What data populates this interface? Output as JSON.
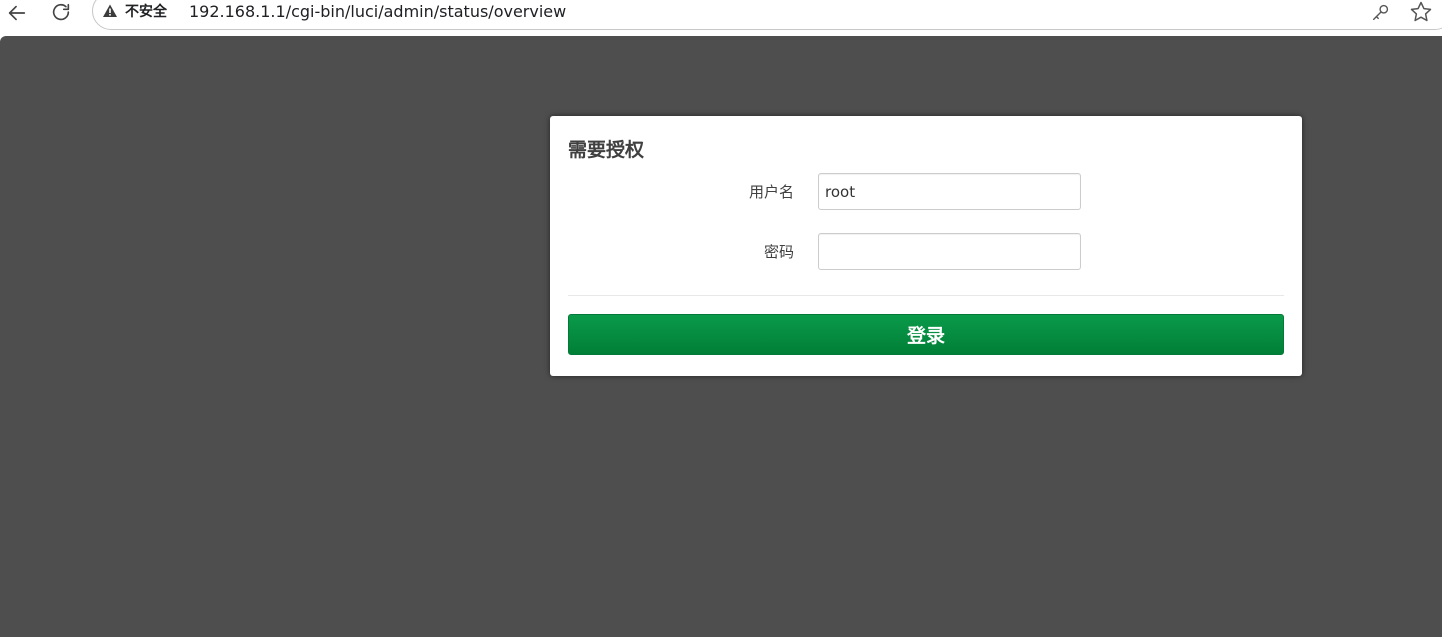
{
  "browser": {
    "back_icon": "arrow-left-icon",
    "reload_icon": "reload-icon",
    "security_icon": "warning-triangle-icon",
    "security_label": "不安全",
    "url": "192.168.1.1/cgi-bin/luci/admin/status/overview",
    "password_manager_icon": "key-icon",
    "bookmark_icon": "star-icon"
  },
  "page": {
    "background_color": "#4e4e4e"
  },
  "login": {
    "title": "需要授权",
    "username_label": "用户名",
    "username_value": "root",
    "password_label": "密码",
    "password_value": "",
    "submit_label": "登录",
    "submit_color": "#018c3f"
  }
}
